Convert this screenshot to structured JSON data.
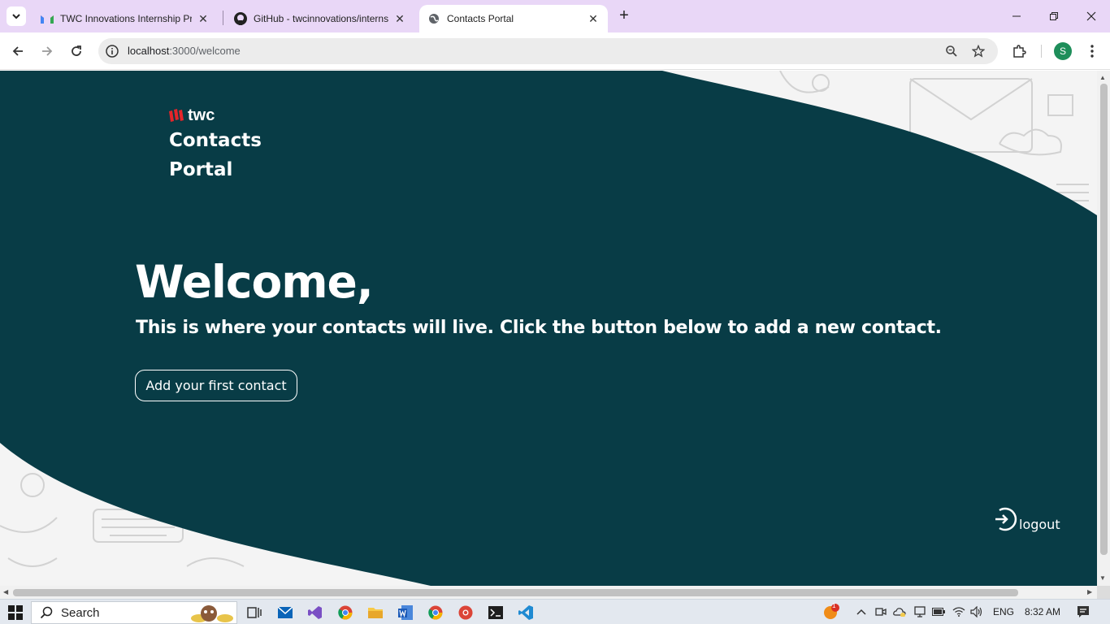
{
  "browser": {
    "tabs": [
      {
        "title": "TWC Innovations Internship Pro",
        "icon": "gmail-icon",
        "active": false
      },
      {
        "title": "GitHub - twcinnovations/interns",
        "icon": "github-icon",
        "active": false
      },
      {
        "title": "Contacts Portal",
        "icon": "globe-icon",
        "active": true
      }
    ],
    "address": {
      "host": "localhost",
      "path": ":3000/welcome"
    },
    "profile_initial": "S"
  },
  "page": {
    "brand": {
      "logo_text": "twc",
      "title": "Contacts Portal"
    },
    "heading": "Welcome,",
    "subheading": "This is where your contacts will live. Click the button below to add a new contact.",
    "add_button_label": "Add your first contact",
    "logout_label": "logout",
    "colors": {
      "panel": "#083c46",
      "brand_accent": "#e5252a",
      "background": "#f4f4f4"
    }
  },
  "taskbar": {
    "search_label": "Search",
    "language": "ENG",
    "time": "8:32 AM",
    "notification_count": "1"
  }
}
